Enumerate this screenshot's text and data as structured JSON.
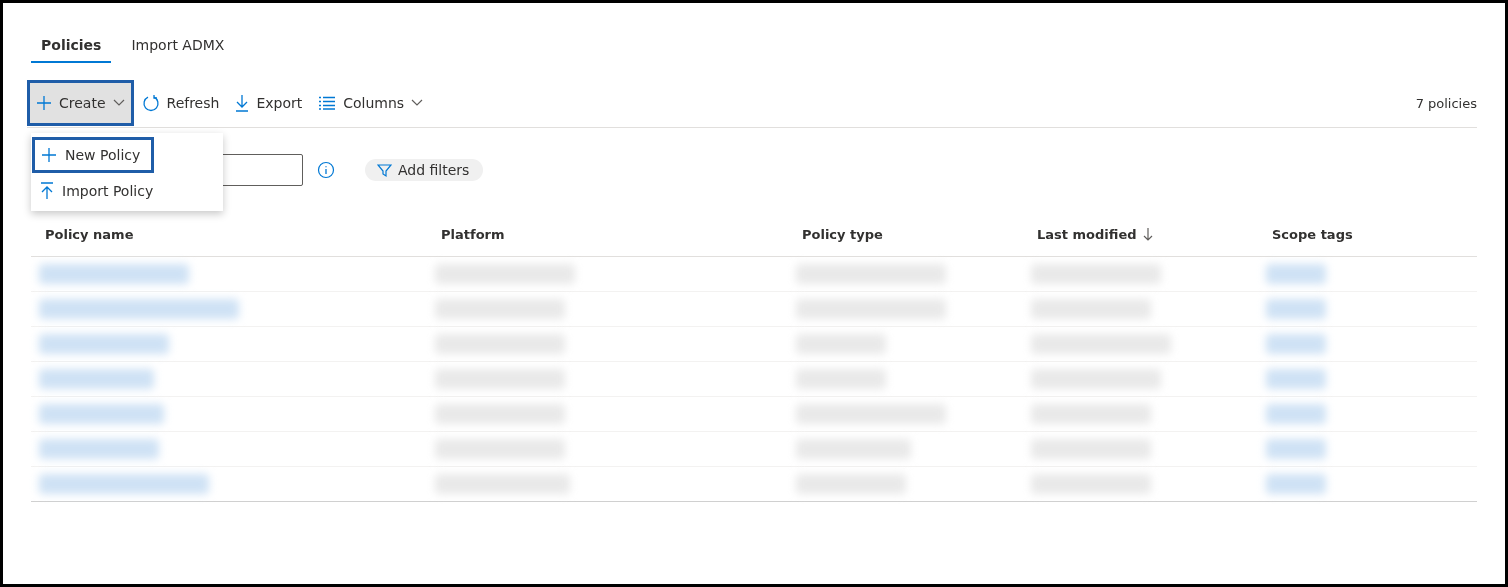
{
  "tabs": [
    {
      "label": "Policies",
      "selected": true
    },
    {
      "label": "Import ADMX",
      "selected": false
    }
  ],
  "toolbar": {
    "create": {
      "label": "Create",
      "expanded": true,
      "highlighted": true
    },
    "actions": [
      {
        "kind": "refresh",
        "label": "Refresh"
      },
      {
        "kind": "export",
        "label": "Export"
      },
      {
        "kind": "columns",
        "label": "Columns"
      }
    ],
    "count": "7 policies"
  },
  "create_menu": [
    {
      "kind": "new",
      "label": "New Policy",
      "highlighted": true
    },
    {
      "kind": "import",
      "label": "Import Policy",
      "highlighted": false
    }
  ],
  "filter_button": "Add filters",
  "table": {
    "columns": [
      {
        "label": "Policy name",
        "sorted": false
      },
      {
        "label": "Platform",
        "sorted": false
      },
      {
        "label": "Policy type",
        "sorted": false
      },
      {
        "label": "Last modified",
        "sorted": true
      },
      {
        "label": "Scope tags",
        "sorted": false
      }
    ],
    "rows": [
      {
        "kind": "blurred"
      },
      {
        "kind": "blurred"
      },
      {
        "kind": "blurred"
      },
      {
        "kind": "blurred"
      },
      {
        "kind": "blurred"
      },
      {
        "kind": "blurred"
      },
      {
        "kind": "blurred"
      }
    ]
  }
}
